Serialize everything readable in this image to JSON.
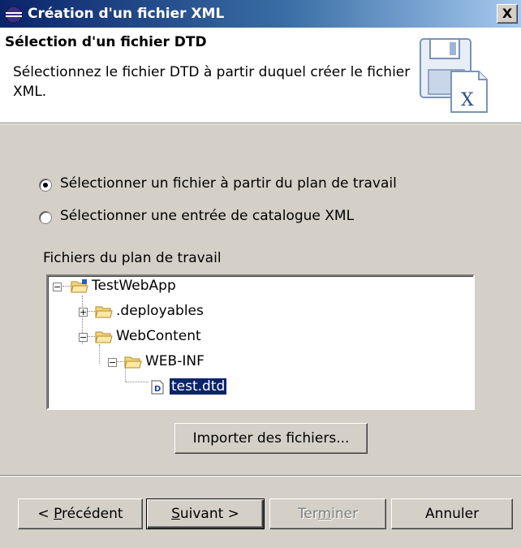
{
  "window": {
    "title": "Création d'un fichier XML",
    "close_label": "X"
  },
  "header": {
    "title": "Sélection d'un fichier DTD",
    "description": "Sélectionnez le fichier DTD à partir duquel créer le fichier XML."
  },
  "source_options": [
    {
      "label": "Sélectionner un fichier à partir du plan de travail",
      "checked": true
    },
    {
      "label": "Sélectionner une entrée de catalogue XML",
      "checked": false
    }
  ],
  "files_label": "Fichiers du plan de travail",
  "tree": [
    {
      "label": "TestWebApp",
      "expander": "−",
      "icon": "project-folder-icon"
    },
    {
      "label": ".deployables",
      "expander": "+",
      "icon": "folder-icon"
    },
    {
      "label": "WebContent",
      "expander": "−",
      "icon": "folder-icon"
    },
    {
      "label": "WEB-INF",
      "expander": "−",
      "icon": "folder-icon"
    },
    {
      "label": "test.dtd",
      "icon": "dtd-file-icon",
      "selected": true
    }
  ],
  "import_button": "Importer des fichiers...",
  "footer": {
    "back": {
      "prefix": "< ",
      "mnemonic": "P",
      "rest": "récédent"
    },
    "next": {
      "mnemonic": "S",
      "rest": "uivant >"
    },
    "finish": {
      "before": "Ter",
      "mnemonic": "m",
      "rest": "iner",
      "disabled": true
    },
    "cancel": "Annuler"
  },
  "colors": {
    "selection": "#0a246a",
    "dialog_bg": "#d4d0c8",
    "title_gradient_start": "#0a246a"
  }
}
